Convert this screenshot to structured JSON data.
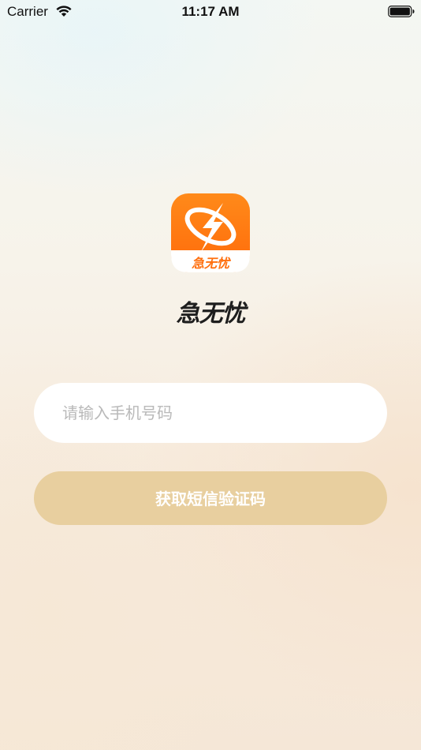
{
  "status_bar": {
    "carrier": "Carrier",
    "time": "11:17 AM",
    "icons": [
      "wifi-icon",
      "battery-icon"
    ]
  },
  "logo": {
    "icon": "lightning-bolt-icon",
    "label": "急无忧",
    "colors": {
      "primary": "#ff7a12",
      "secondary": "#ffffff"
    }
  },
  "brand": {
    "title": "急无忧"
  },
  "login": {
    "phone_placeholder": "请输入手机号码",
    "phone_value": "",
    "submit_label": "获取短信验证码",
    "submit_color": "#e8cf9f"
  }
}
